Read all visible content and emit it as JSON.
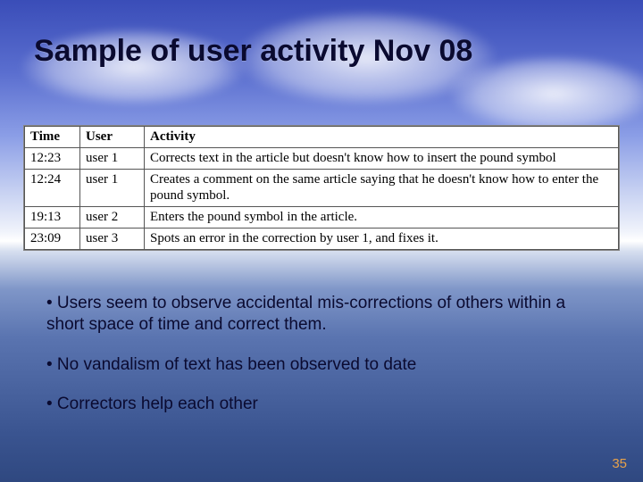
{
  "title": "Sample of user activity Nov 08",
  "table": {
    "headers": [
      "Time",
      "User",
      "Activity"
    ],
    "rows": [
      [
        "12:23",
        "user 1",
        "Corrects text in the article but doesn't know how to insert the pound symbol"
      ],
      [
        "12:24",
        "user 1",
        "Creates a comment on the same article saying that he doesn't know how to enter the pound symbol."
      ],
      [
        "19:13",
        "user 2",
        "Enters the pound symbol in the article."
      ],
      [
        "23:09",
        "user 3",
        "Spots an error in the correction by user 1, and fixes it."
      ]
    ]
  },
  "bullets": [
    "• Users seem to observe accidental mis-corrections of others within a short space of time and correct them.",
    "• No vandalism of text has been observed to date",
    "• Correctors help each other"
  ],
  "page_number": "35"
}
